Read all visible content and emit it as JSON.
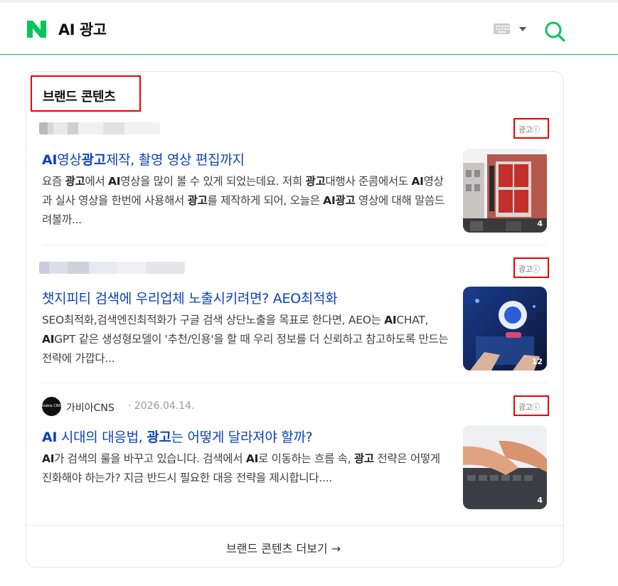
{
  "header": {
    "query": "AI 광고",
    "brand_color": "#03c75a"
  },
  "section": {
    "title": "브랜드 콘텐츠",
    "more_label": "브랜드 콘텐츠 더보기",
    "more_arrow": "→"
  },
  "items": [
    {
      "ad_label": "광고ⓘ",
      "title_parts": [
        {
          "t": "AI",
          "b": true
        },
        {
          "t": "영상",
          "b": false
        },
        {
          "t": "광고",
          "b": true
        },
        {
          "t": "제작, 촬영 영상 편집까지",
          "b": false
        }
      ],
      "desc_parts": [
        {
          "t": "요즘 ",
          "b": false
        },
        {
          "t": "광고",
          "b": true
        },
        {
          "t": "에서 ",
          "b": false
        },
        {
          "t": "AI",
          "b": true
        },
        {
          "t": "영상을 많이 볼 수 있게 되었는데요. 저희 ",
          "b": false
        },
        {
          "t": "광고",
          "b": true
        },
        {
          "t": "대행사 준콤에서도 ",
          "b": false
        },
        {
          "t": "AI",
          "b": true
        },
        {
          "t": "영상과 실사 영상을 한번에 사용해서 ",
          "b": false
        },
        {
          "t": "광고",
          "b": true
        },
        {
          "t": "를 제작하게 되어, 오늘은 ",
          "b": false
        },
        {
          "t": "AI광고",
          "b": true
        },
        {
          "t": " 영상에 대해 말씀드려볼까...",
          "b": false
        }
      ],
      "image_count": "4"
    },
    {
      "ad_label": "광고ⓘ",
      "title_parts": [
        {
          "t": "챗지피티 검색에 우리업체 노출시키려면? AEO최적화",
          "b": false
        }
      ],
      "desc_parts": [
        {
          "t": "SEO최적화,검색엔진최적화가 구글 검색 상단노출을 목표로 한다면, AEO는 ",
          "b": false
        },
        {
          "t": "AI",
          "b": true
        },
        {
          "t": "CHAT, ",
          "b": false
        },
        {
          "t": "AI",
          "b": true
        },
        {
          "t": "GPT 같은 생성형모델이 '추천/인용'을 할 때 우리 정보를 더 신뢰하고 참고하도록 만드는 전략에 가깝다...",
          "b": false
        }
      ],
      "image_count": "12"
    },
    {
      "ad_label": "광고ⓘ",
      "source_name": "가비아CNS",
      "date": "· 2026.04.14.",
      "avatar_text": "Gabia CNS",
      "title_parts": [
        {
          "t": "AI",
          "b": true
        },
        {
          "t": " 시대의 대응법, ",
          "b": false
        },
        {
          "t": "광고",
          "b": true
        },
        {
          "t": "는 어떻게 달라져야 할까?",
          "b": false
        }
      ],
      "desc_parts": [
        {
          "t": "AI",
          "b": true
        },
        {
          "t": "가 검색의 룰을 바꾸고 있습니다. 검색에서 ",
          "b": false
        },
        {
          "t": "AI",
          "b": true
        },
        {
          "t": "로 이동하는 흐름 속, ",
          "b": false
        },
        {
          "t": "광고",
          "b": true
        },
        {
          "t": " 전략은 어떻게 진화해야 하는가? 지금 반드시 필요한 대응 전략을 제시합니다....",
          "b": false
        }
      ],
      "image_count": "4"
    }
  ]
}
